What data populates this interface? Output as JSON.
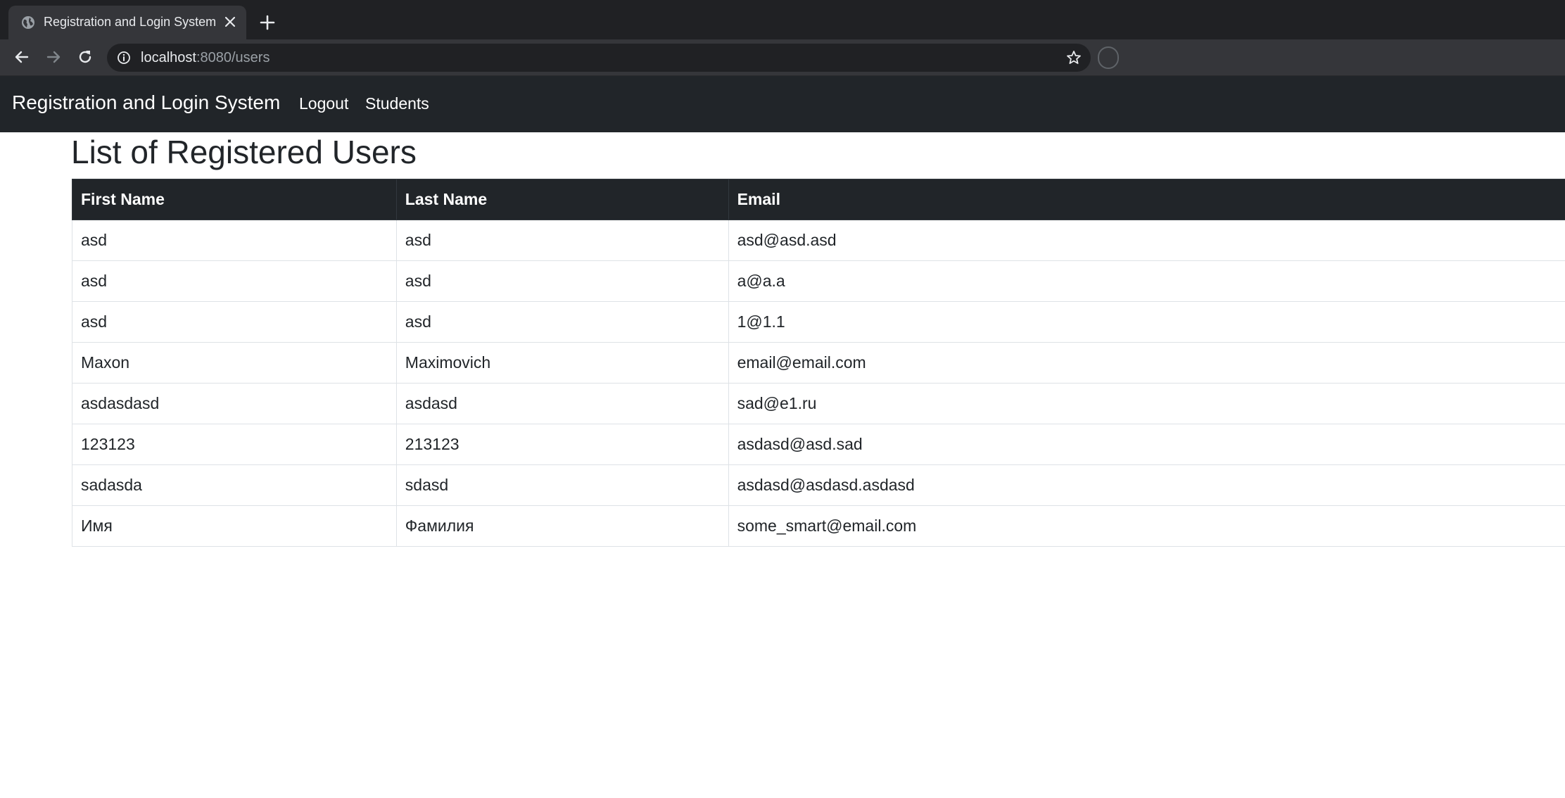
{
  "browser": {
    "tab_title": "Registration and Login System",
    "url_host": "localhost",
    "url_rest": ":8080/users"
  },
  "navbar": {
    "brand": "Registration and Login System",
    "links": [
      {
        "label": "Logout"
      },
      {
        "label": "Students"
      }
    ]
  },
  "page": {
    "heading": "List of Registered Users"
  },
  "table": {
    "columns": [
      "First Name",
      "Last Name",
      "Email"
    ],
    "rows": [
      [
        "asd",
        "asd",
        "asd@asd.asd"
      ],
      [
        "asd",
        "asd",
        "a@a.a"
      ],
      [
        "asd",
        "asd",
        "1@1.1"
      ],
      [
        "Maxon",
        "Maximovich",
        "email@email.com"
      ],
      [
        "asdasdasd",
        "asdasd",
        "sad@e1.ru"
      ],
      [
        "123123",
        "213123",
        "asdasd@asd.sad"
      ],
      [
        "sadasda",
        "sdasd",
        "asdasd@asdasd.asdasd"
      ],
      [
        "Имя",
        "Фамилия",
        "some_smart@email.com"
      ]
    ]
  },
  "icons": {
    "tab_favicon": "globe-icon",
    "tab_close": "close-icon",
    "new_tab": "plus-icon",
    "back": "arrow-left-icon",
    "forward": "arrow-right-icon",
    "reload": "reload-icon",
    "site_info": "info-icon",
    "bookmark": "star-icon"
  },
  "colors": {
    "navbar_bg": "#212529",
    "chrome_dark": "#202124",
    "chrome_mid": "#35363a",
    "table_border": "#dee2e6"
  }
}
